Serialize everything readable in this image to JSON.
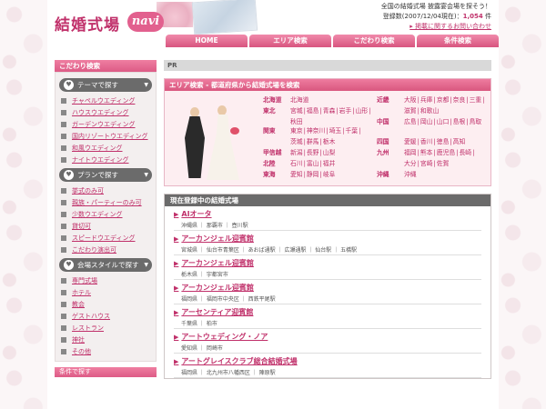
{
  "header": {
    "logo_text": "結婚式場",
    "logo_sub": "navi",
    "tagline": "全国の結婚式場 披露宴会場を探そう！",
    "count_prefix": "登録数(2007/12/04現在)：",
    "count_value": "1,054",
    "count_suffix": " 件",
    "publish_link": "掲載に関するお問い合わせ"
  },
  "nav": [
    "HOME",
    "エリア検索",
    "こだわり検索",
    "条件検索"
  ],
  "sidebar": {
    "title": "こだわり検索",
    "sections": [
      {
        "title": "テーマで探す",
        "icon": "heart-icon",
        "items": [
          "チャペルウエディング",
          "ハウスウエディング",
          "ガーデンウエディング",
          "国内リゾートウエディング",
          "和風ウエディング",
          "ナイトウエディング"
        ]
      },
      {
        "title": "プランで探す",
        "icon": "heart-icon",
        "items": [
          "挙式のみ可",
          "親族・パーティーのみ可",
          "少数ウエディング",
          "貸切可",
          "スピードウエディング",
          "こだわり演出可"
        ]
      },
      {
        "title": "会場スタイルで探す",
        "icon": "heart-icon",
        "items": [
          "専門式場",
          "ホテル",
          "教会",
          "ゲストハウス",
          "レストラン",
          "神社",
          "その他"
        ]
      }
    ],
    "next_title": "条件で探す"
  },
  "main": {
    "pr_label": "PR",
    "area_title": "エリア検索 - 都道府県から結婚式場を検索",
    "regions": [
      {
        "name": "北海道",
        "prefs": [
          "北海道"
        ]
      },
      {
        "name": "東北",
        "prefs": [
          "宮城",
          "福島",
          "青森",
          "岩手",
          "山形",
          "秋田"
        ]
      },
      {
        "name": "関東",
        "prefs": [
          "東京",
          "神奈川",
          "埼玉",
          "千葉",
          "茨城",
          "群馬",
          "栃木"
        ]
      },
      {
        "name": "甲信越",
        "prefs": [
          "新潟",
          "長野",
          "山梨"
        ]
      },
      {
        "name": "北陸",
        "prefs": [
          "石川",
          "富山",
          "福井"
        ]
      },
      {
        "name": "東海",
        "prefs": [
          "愛知",
          "静岡",
          "岐阜"
        ]
      },
      {
        "name": "近畿",
        "prefs": [
          "大阪",
          "兵庫",
          "京都",
          "奈良",
          "三重",
          "滋賀",
          "和歌山"
        ]
      },
      {
        "name": "中国",
        "prefs": [
          "広島",
          "岡山",
          "山口",
          "島根",
          "鳥取"
        ]
      },
      {
        "name": "四国",
        "prefs": [
          "愛媛",
          "香川",
          "徳島",
          "高知"
        ]
      },
      {
        "name": "九州",
        "prefs": [
          "福岡",
          "熊本",
          "鹿児島",
          "長崎",
          "大分",
          "宮崎",
          "佐賀"
        ]
      },
      {
        "name": "沖縄",
        "prefs": [
          "沖縄"
        ]
      }
    ],
    "current_title": "現在登録中の結婚式場",
    "venues": [
      {
        "name": "AIオータ",
        "loc": "沖縄県 ｜ 那覇市 ｜ 壺川駅"
      },
      {
        "name": "アーカンジェル迎賓館",
        "loc": "宮城県 ｜ 仙台市青葉区 ｜ あおば通駅 ｜ 広瀬通駅 ｜ 仙台駅 ｜ 五橋駅"
      },
      {
        "name": "アーカンジェル迎賓館",
        "loc": "栃木県 ｜ 宇都宮市"
      },
      {
        "name": "アーカンジェル迎賓館",
        "loc": "福岡県 ｜ 福岡市中央区 ｜ 西鉄平尾駅"
      },
      {
        "name": "アーセンティア迎賓館",
        "loc": "千葉県 ｜ 柏市"
      },
      {
        "name": "アートウェディング・ノア",
        "loc": "愛知県 ｜ 岡崎市"
      },
      {
        "name": "アートグレイスクラブ総合結婚式場",
        "loc": "福岡県 ｜ 北九州市八幡西区 ｜ 陣原駅"
      }
    ]
  }
}
